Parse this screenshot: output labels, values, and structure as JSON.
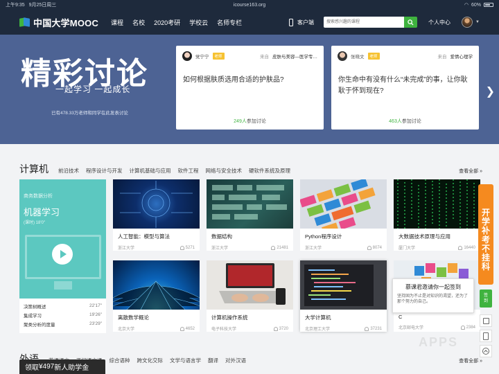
{
  "status_bar": {
    "time": "上午9:35",
    "date": "9月25日周三",
    "url": "icourse163.org",
    "battery": "60%"
  },
  "nav": {
    "logo_text": "中国大学MOOC",
    "links": [
      "课程",
      "名校",
      "2020考研",
      "学校云",
      "名师专栏"
    ],
    "client_label": "客户端",
    "search_placeholder": "搜索感兴趣的课程",
    "personal_label": "个人中心"
  },
  "hero": {
    "title": "精彩讨论",
    "subtitle": "一起学习 一起成长",
    "note": "已有478.33万老师和同学在此发表讨论",
    "discussions": [
      {
        "user": "党宁宁",
        "badge": "老师",
        "from_label": "来自",
        "source": "皮肤与美容—医学专…",
        "question": "如何根据肤质选用合适的护肤品?",
        "participants": "249人",
        "join_label": "参加讨论"
      },
      {
        "user": "张晓文",
        "badge": "老师",
        "from_label": "来自",
        "source": "爱情心理学",
        "question": "你生命中有没有什么“未完成”的事，让你耿耿于怀到现在?",
        "participants": "463人",
        "join_label": "参加讨论"
      }
    ]
  },
  "section": {
    "title": "计算机",
    "tabs": [
      "前沿技术",
      "程序设计与开发",
      "计算机基础与应用",
      "软件工程",
      "网络与安全技术",
      "硬软件系统及原理"
    ],
    "more": "查看全部 »"
  },
  "featured": {
    "top": "商务数据分析",
    "title": "机器学习",
    "meta": "(课时) 18'0\"",
    "chapters": [
      {
        "name": "决策树概述",
        "time": "22'17\""
      },
      {
        "name": "集成学习",
        "time": "19'26\""
      },
      {
        "name": "聚类分析的度量",
        "time": "23'29\""
      }
    ]
  },
  "courses": [
    {
      "name": "人工智能：模型与算法",
      "school": "浙江大学",
      "count": "5271"
    },
    {
      "name": "数据结构",
      "school": "浙江大学",
      "count": "21481"
    },
    {
      "name": "Python程序设计",
      "school": "浙江大学",
      "count": "8074"
    },
    {
      "name": "大数据技术原理与应用",
      "school": "厦门大学",
      "count": "16440"
    },
    {
      "name": "离散数学概论",
      "school": "北京大学",
      "count": "4652"
    },
    {
      "name": "计算机操作系统",
      "school": "电子科技大学",
      "count": "3720"
    },
    {
      "name": "大学计算机",
      "school": "北京理工大学",
      "count": "37231"
    },
    {
      "name": "C",
      "school": "北京邮电大学",
      "count": "2384"
    }
  ],
  "popup": {
    "title": "慕课君邀请你一起签到",
    "body": "坚持固为不止是对知识的渴望，还为了那个努力的自己。"
  },
  "dock": {
    "banner": [
      "开",
      "学",
      "补",
      "考",
      "不",
      "挂",
      "科"
    ],
    "sign_label": [
      "签",
      "到"
    ]
  },
  "section2": {
    "title": "外语",
    "tabs": [
      "英语语言",
      "西门语言通",
      "综合语种",
      "跨文化交际",
      "文学与语言学",
      "翻译",
      "对外汉语"
    ],
    "more": "查看全部 »"
  },
  "promo": {
    "prefix": "领取",
    "amount": "¥497",
    "suffix": "新人助学金"
  },
  "colors": {
    "nav_bg": "#1e2a3c",
    "hero_bg": "#4d6394",
    "accent_green": "#3fb33f",
    "badge_yellow": "#f6c231",
    "dock_orange": "#f58a1f"
  }
}
